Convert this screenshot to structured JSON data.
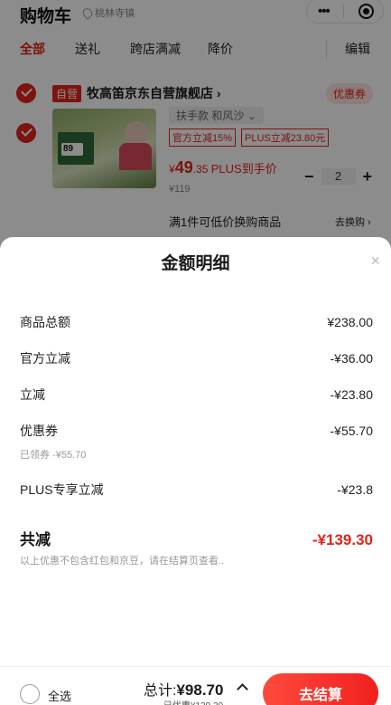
{
  "header": {
    "title": "购物车",
    "location": "桃林寺镇",
    "capsule_more": "•••"
  },
  "tabs": [
    "全部",
    "送礼",
    "跨店满减",
    "降价"
  ],
  "edit_label": "编辑",
  "shop": {
    "self_badge": "自营",
    "name": "牧高笛京东自营旗舰店 ›",
    "coupon_label": "优惠券"
  },
  "product": {
    "spec": "扶手款 和风沙 ⌄",
    "tag_official": "官方立减15%",
    "tag_plus": "PLUS立减23.80元",
    "price_currency": "¥",
    "price_int": "49",
    "price_dec": ".35",
    "price_note": "PLUS到手价",
    "original_price": "¥119",
    "qty": "2",
    "qty_minus": "−",
    "qty_plus": "+",
    "swap_info": "满1件可低价换购商品",
    "swap_link": "去换购 ›",
    "image_price": "89"
  },
  "sheet": {
    "title": "金额明细",
    "close": "×",
    "rows": [
      {
        "label": "商品总额",
        "amount": "¥238.00"
      },
      {
        "label": "官方立减",
        "amount": "-¥36.00"
      },
      {
        "label": "立减",
        "amount": "-¥23.80"
      },
      {
        "label": "优惠券",
        "amount": "-¥55.70"
      },
      {
        "label": "PLUS专享立减",
        "amount": "-¥23.8"
      }
    ],
    "coupon_note": "已领券 -¥55.70",
    "total_label": "共减",
    "total_amount": "-¥139.30",
    "footnote": "以上优惠不包含红包和京豆，请在结算页查看.."
  },
  "bottom_bar": {
    "select_all": "全选",
    "total_prefix": "总计:",
    "total_value": "¥98.70",
    "saved": "已优惠¥139.30",
    "checkout": "去结算"
  },
  "colors": {
    "accent": "#e2231a",
    "checkout_start": "#ff4a3d",
    "checkout_end": "#f0201e"
  }
}
